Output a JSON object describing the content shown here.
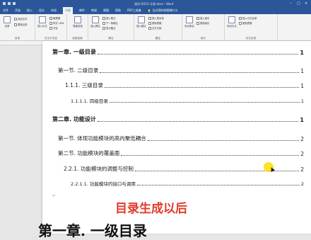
{
  "window": {
    "title": "测试 DOCX 文档.docx - Word"
  },
  "tabs": [
    {
      "label": "文件",
      "active": false
    },
    {
      "label": "开始",
      "active": true
    },
    {
      "label": "插入",
      "active": false
    },
    {
      "label": "设计",
      "active": false
    },
    {
      "label": "布局",
      "active": false
    },
    {
      "label": "引用",
      "active": false
    },
    {
      "label": "邮件",
      "active": false
    },
    {
      "label": "审阅",
      "active": false
    },
    {
      "label": "视图",
      "active": false
    },
    {
      "label": "帮助",
      "active": false
    },
    {
      "label": "PDF工具集",
      "active": false
    }
  ],
  "tell_me": "告诉我你想要做什么",
  "ribbon": {
    "toc_group": {
      "label": "目录",
      "big": "目录",
      "add_text": "添加文字",
      "update": "更新目录"
    },
    "footnote_group": {
      "label": "脚注",
      "big": "插入脚注",
      "endnote": "插入尾注",
      "next": "下一条脚注",
      "show": "显示备注"
    },
    "research_group": {
      "label": "信息检索",
      "big": "智能查找"
    },
    "citation_group": {
      "label": "引文与书目",
      "big": "插入引文",
      "manage": "管理源",
      "style": "样式: APA",
      "biblio": "书目"
    },
    "caption_group": {
      "label": "题注",
      "big": "插入题注",
      "table": "插入表目录",
      "update": "更新表格",
      "cross": "交叉引用"
    },
    "index_group": {
      "label": "索引",
      "big": "标记条目",
      "insert": "插入索引",
      "update": "更新索引"
    },
    "authorities_group": {
      "label": "引文目录",
      "big": "标记引文",
      "insert": "插入引文目录",
      "update": "更新表格"
    }
  },
  "toc": [
    {
      "text": "第一章.   一级目录",
      "page": "1",
      "level": 0
    },
    {
      "text": "第一节. 二级目录",
      "page": "1",
      "level": 1
    },
    {
      "text": "1.1.1.  三级目录",
      "page": "1",
      "level": 2
    },
    {
      "text": "1.1.1.1.  四级目录",
      "page": "1",
      "level": 3
    },
    {
      "text": "第二章.   功能设计",
      "page": "1",
      "level": 0
    },
    {
      "text": "第一节. 体现功能模块的高内聚低耦合",
      "page": "2",
      "level": 1
    },
    {
      "text": "第二节. 功能模块的覆盖面",
      "page": "2",
      "level": 1
    },
    {
      "text": "2.2.1.  功能模块的调整与控制",
      "page": "2",
      "level": 2
    },
    {
      "text": "2.2.1.1.  功能模块的接口与调用",
      "page": "2",
      "level": 3
    }
  ],
  "caption": "目录生成以后",
  "body_heading": "第一章.   一级目录",
  "accent": "#2b579a",
  "caption_color": "#e23a2a"
}
